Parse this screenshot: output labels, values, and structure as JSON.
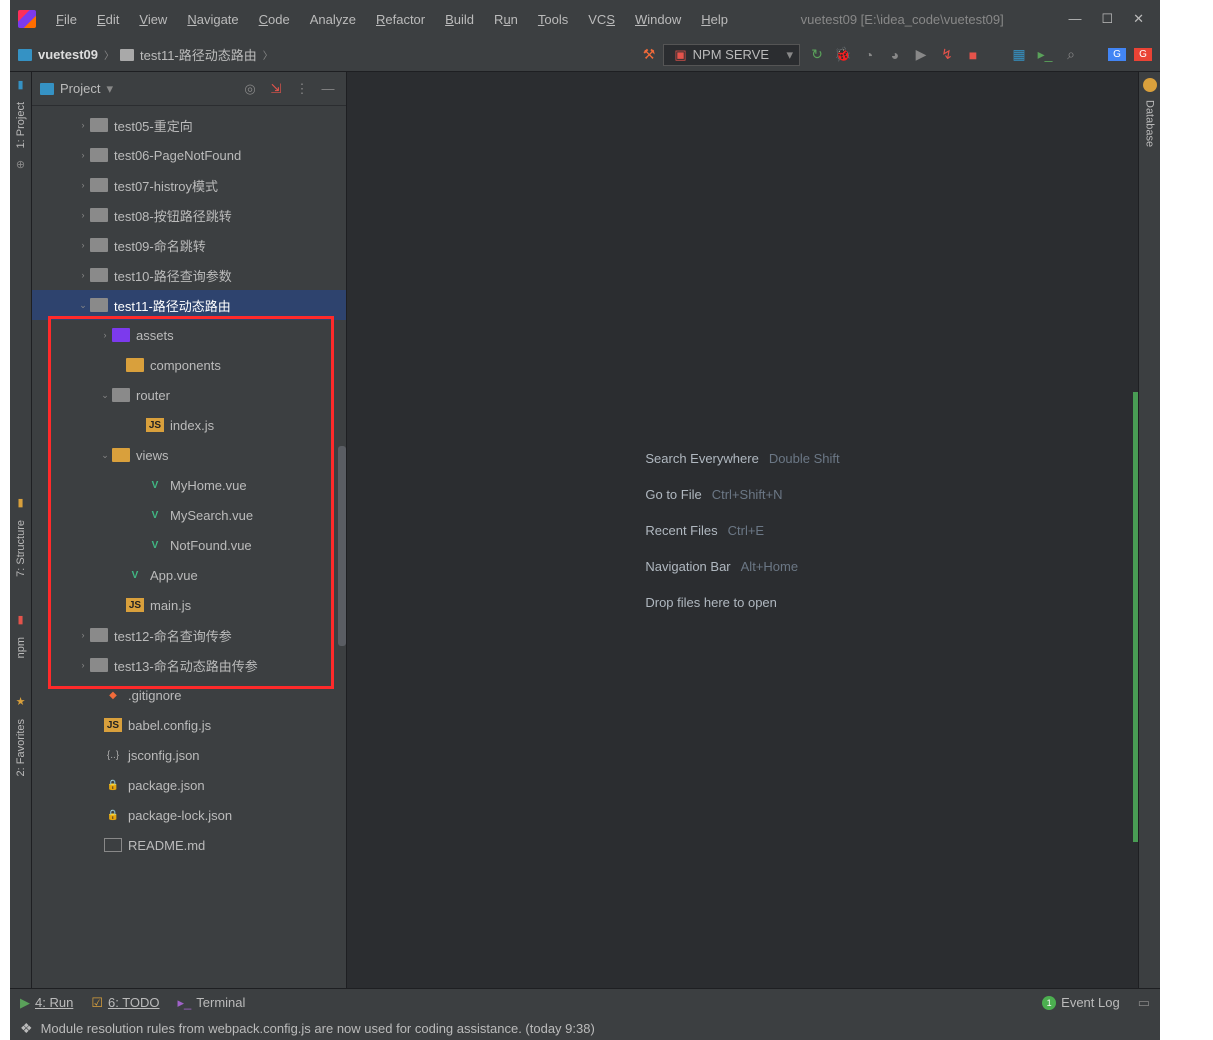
{
  "title": "vuetest09 [E:\\idea_code\\vuetest09]",
  "menus": [
    "File",
    "Edit",
    "View",
    "Navigate",
    "Code",
    "Analyze",
    "Refactor",
    "Build",
    "Run",
    "Tools",
    "VCS",
    "Window",
    "Help"
  ],
  "breadcrumb": {
    "root": "vuetest09",
    "sub": "test11-路径动态路由"
  },
  "runconfig": "NPM SERVE",
  "sidebar": {
    "title": "Project"
  },
  "tree": [
    {
      "ind": 44,
      "arr": "›",
      "ic": "fold",
      "label": "test05-重定向"
    },
    {
      "ind": 44,
      "arr": "›",
      "ic": "fold",
      "label": "test06-PageNotFound"
    },
    {
      "ind": 44,
      "arr": "›",
      "ic": "fold",
      "label": "test07-histroy模式"
    },
    {
      "ind": 44,
      "arr": "›",
      "ic": "fold",
      "label": "test08-按钮路径跳转"
    },
    {
      "ind": 44,
      "arr": "›",
      "ic": "fold",
      "label": "test09-命名跳转"
    },
    {
      "ind": 44,
      "arr": "›",
      "ic": "fold",
      "label": "test10-路径查询参数"
    },
    {
      "ind": 44,
      "arr": "⌄",
      "ic": "fold",
      "label": "test11-路径动态路由",
      "sel": true
    },
    {
      "ind": 66,
      "arr": "›",
      "ic": "foldp",
      "label": "assets"
    },
    {
      "ind": 80,
      "arr": "",
      "ic": "foldo",
      "label": "components"
    },
    {
      "ind": 66,
      "arr": "⌄",
      "ic": "fold",
      "label": "router"
    },
    {
      "ind": 100,
      "arr": "",
      "ic": "js",
      "label": "index.js"
    },
    {
      "ind": 66,
      "arr": "⌄",
      "ic": "foldo",
      "label": "views"
    },
    {
      "ind": 100,
      "arr": "",
      "ic": "vue",
      "label": "MyHome.vue"
    },
    {
      "ind": 100,
      "arr": "",
      "ic": "vue",
      "label": "MySearch.vue"
    },
    {
      "ind": 100,
      "arr": "",
      "ic": "vue",
      "label": "NotFound.vue"
    },
    {
      "ind": 80,
      "arr": "",
      "ic": "vue",
      "label": "App.vue"
    },
    {
      "ind": 80,
      "arr": "",
      "ic": "js",
      "label": "main.js"
    },
    {
      "ind": 44,
      "arr": "›",
      "ic": "fold",
      "label": "test12-命名查询传参"
    },
    {
      "ind": 44,
      "arr": "›",
      "ic": "fold",
      "label": "test13-命名动态路由传参"
    },
    {
      "ind": 58,
      "arr": "",
      "ic": "git",
      "label": ".gitignore"
    },
    {
      "ind": 58,
      "arr": "",
      "ic": "js",
      "label": "babel.config.js"
    },
    {
      "ind": 58,
      "arr": "",
      "ic": "json",
      "label": "jsconfig.json"
    },
    {
      "ind": 58,
      "arr": "",
      "ic": "lock",
      "label": "package.json"
    },
    {
      "ind": 58,
      "arr": "",
      "ic": "lock",
      "label": "package-lock.json"
    },
    {
      "ind": 58,
      "arr": "",
      "ic": "file",
      "label": "README.md"
    }
  ],
  "welcome": [
    {
      "lbl": "Search Everywhere",
      "key": "Double Shift"
    },
    {
      "lbl": "Go to File",
      "key": "Ctrl+Shift+N"
    },
    {
      "lbl": "Recent Files",
      "key": "Ctrl+E"
    },
    {
      "lbl": "Navigation Bar",
      "key": "Alt+Home"
    },
    {
      "lbl": "Drop files here to open",
      "key": ""
    }
  ],
  "leftrail": [
    {
      "lbl": "1: Project"
    },
    {
      "lbl": "7: Structure"
    },
    {
      "lbl": "npm"
    },
    {
      "lbl": "2: Favorites"
    }
  ],
  "rightrail": {
    "label": "Database"
  },
  "bottom": {
    "run": "4: Run",
    "todo": "6: TODO",
    "term": "Terminal",
    "evlog": "Event Log",
    "evcount": "1"
  },
  "status": "Module resolution rules from webpack.config.js are now used for coding assistance. (today 9:38)"
}
